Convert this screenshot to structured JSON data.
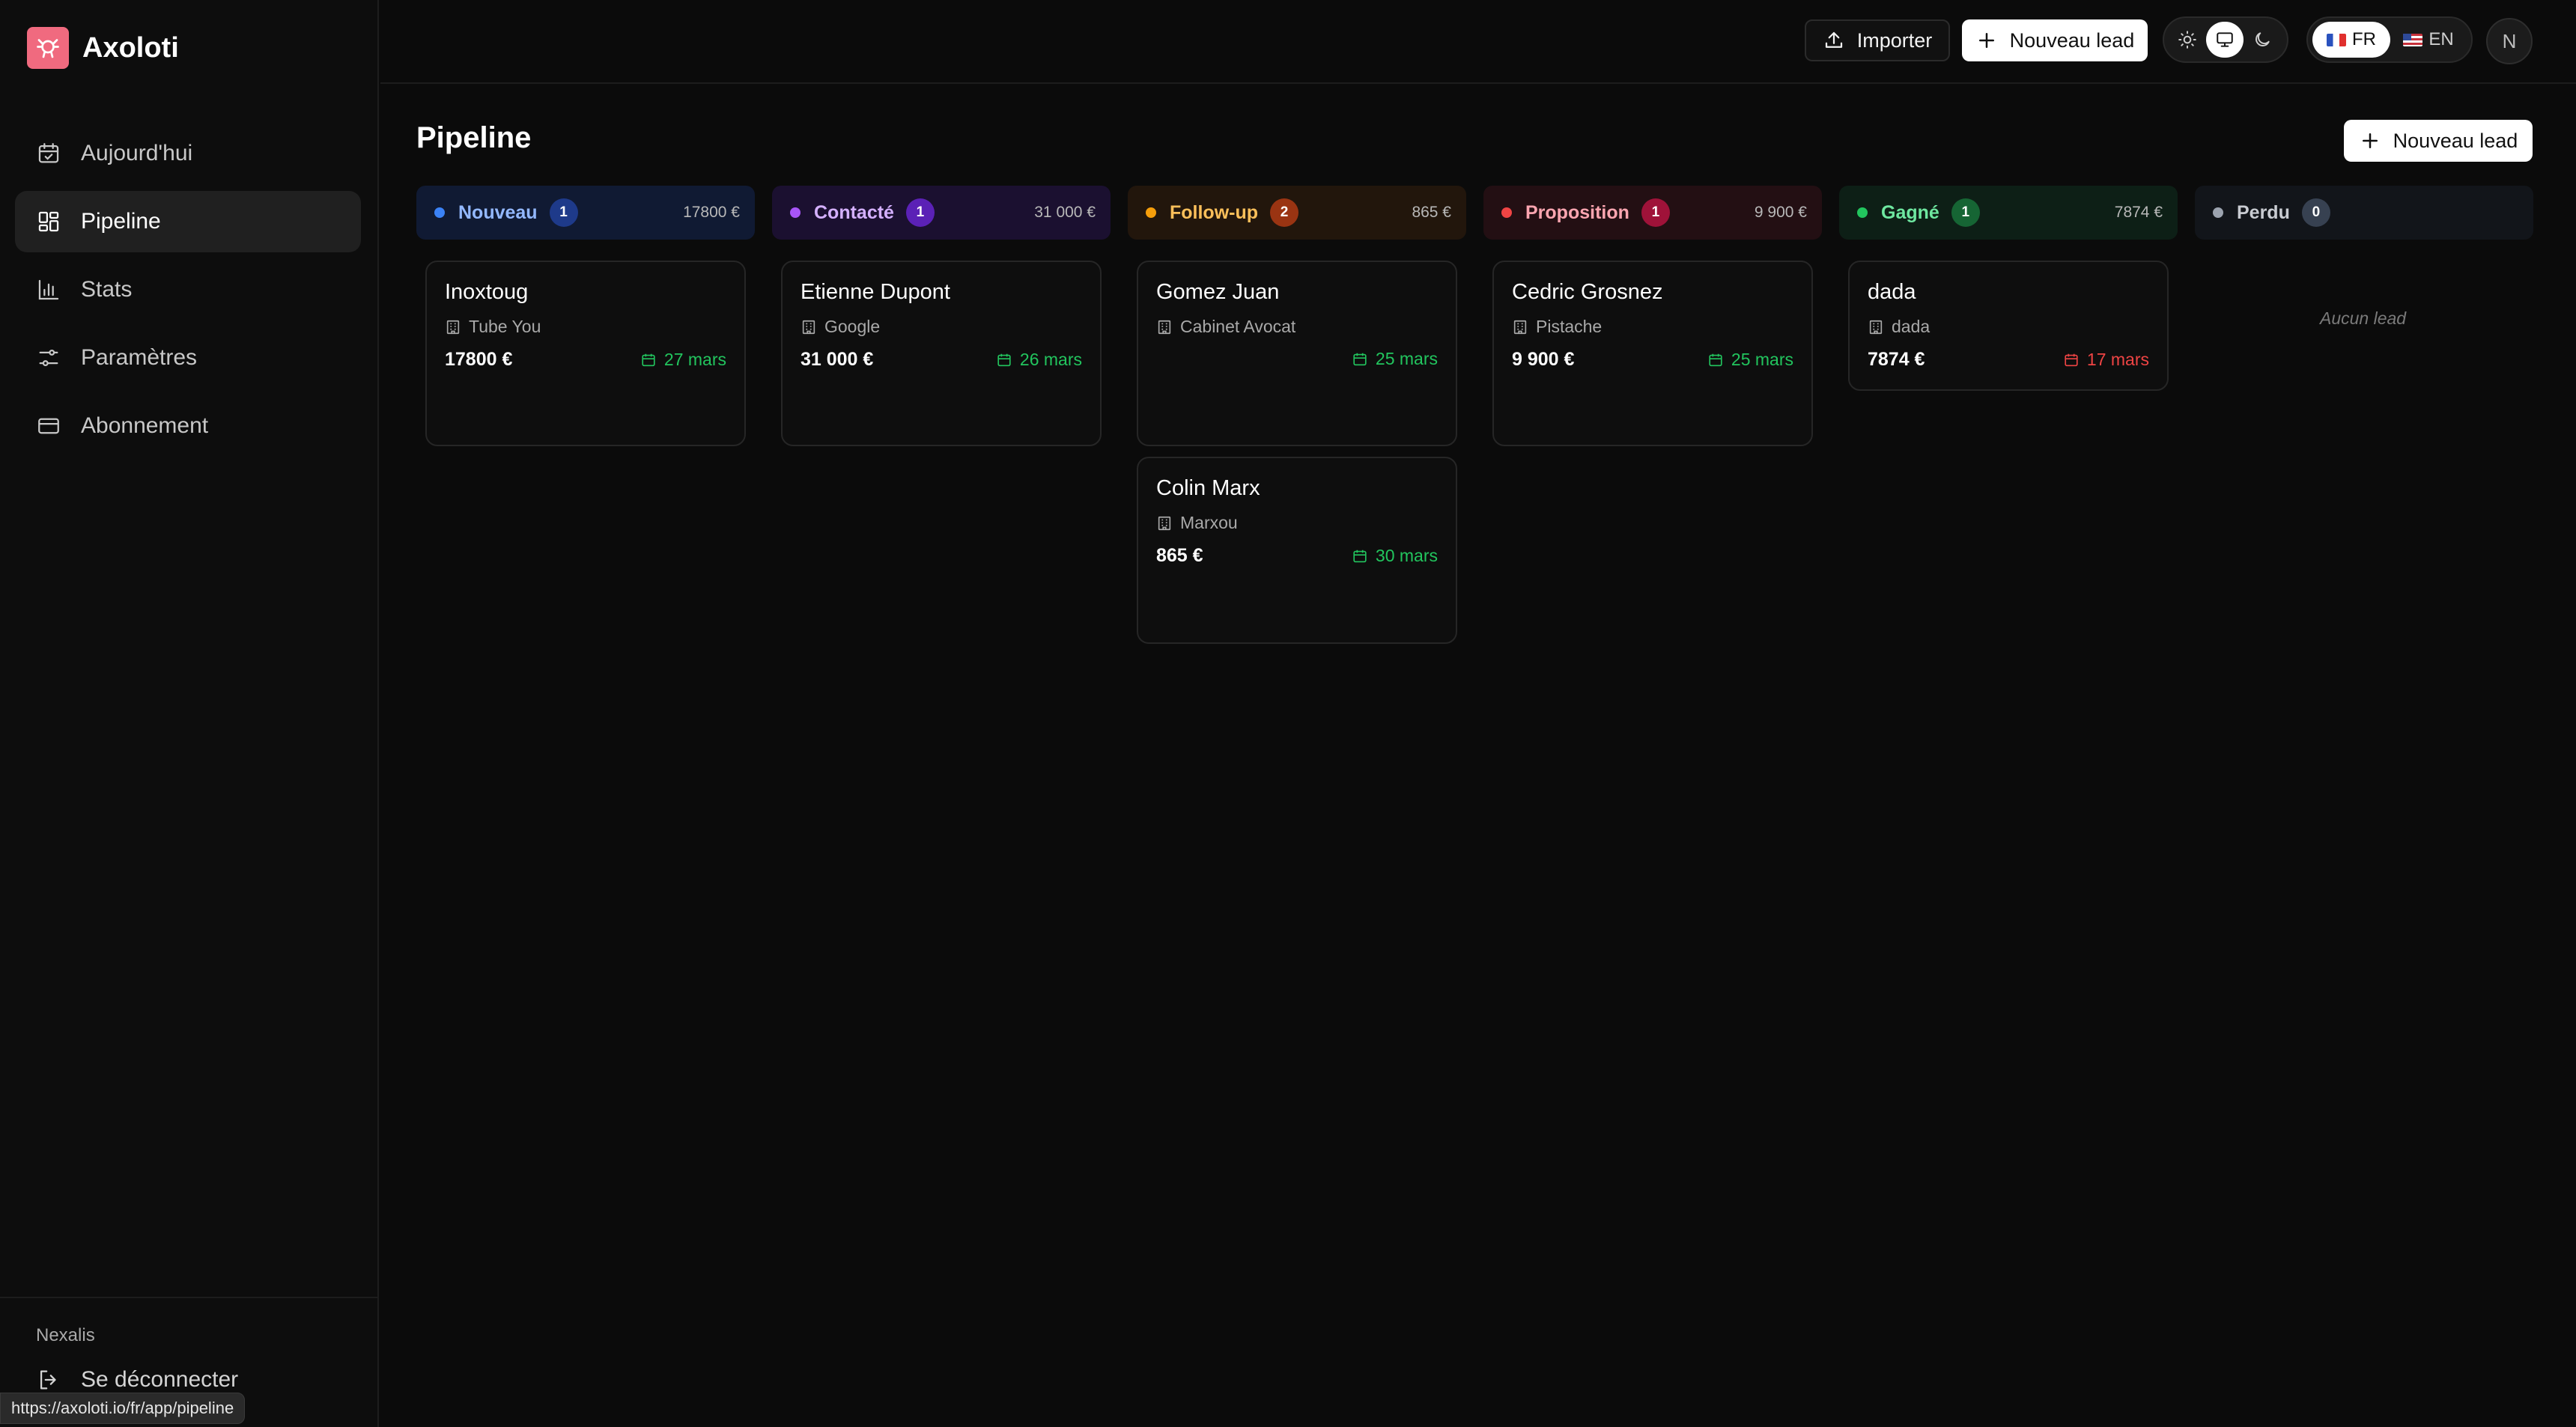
{
  "app": {
    "name": "Axoloti"
  },
  "sidebar": {
    "items": [
      {
        "label": "Aujourd'hui",
        "icon": "calendar-check-icon",
        "active": false
      },
      {
        "label": "Pipeline",
        "icon": "grid-icon",
        "active": true
      },
      {
        "label": "Stats",
        "icon": "bar-chart-icon",
        "active": false
      },
      {
        "label": "Paramètres",
        "icon": "sliders-icon",
        "active": false
      },
      {
        "label": "Abonnement",
        "icon": "credit-card-icon",
        "active": false
      }
    ],
    "org": "Nexalis",
    "logout": "Se déconnecter"
  },
  "statusbar": {
    "url": "https://axoloti.io/fr/app/pipeline"
  },
  "topbar": {
    "import_label": "Importer",
    "new_lead_label": "Nouveau lead",
    "lang_fr": "FR",
    "lang_en": "EN",
    "active_lang": "FR",
    "theme_active": "system",
    "avatar": "N"
  },
  "page": {
    "title": "Pipeline",
    "new_lead_label": "Nouveau lead"
  },
  "pipeline": {
    "columns": [
      {
        "name": "Nouveau",
        "count": "1",
        "total": "17800 €",
        "color": "#3b82f6"
      },
      {
        "name": "Contacté",
        "count": "1",
        "total": "31 000 €",
        "color": "#a855f7"
      },
      {
        "name": "Follow-up",
        "count": "2",
        "total": "865 €",
        "color": "#f59e0b"
      },
      {
        "name": "Proposition",
        "count": "1",
        "total": "9 900 €",
        "color": "#ef4444"
      },
      {
        "name": "Gagné",
        "count": "1",
        "total": "7874 €",
        "color": "#22c55e"
      },
      {
        "name": "Perdu",
        "count": "0",
        "total": "",
        "color": "#9ca3af"
      }
    ],
    "cards": [
      {
        "name": "Inoxtoug",
        "company": "Tube You",
        "value": "17800 €",
        "date": "27 mars",
        "date_status": "ok"
      },
      {
        "name": "Etienne Dupont",
        "company": "Google",
        "value": "31 000 €",
        "date": "26 mars",
        "date_status": "ok"
      },
      {
        "name": "Gomez Juan",
        "company": "Cabinet Avocat",
        "value": "",
        "date": "25 mars",
        "date_status": "ok"
      },
      {
        "name": "Colin Marx",
        "company": "Marxou",
        "value": "865 €",
        "date": "30 mars",
        "date_status": "ok"
      },
      {
        "name": "Cedric Grosnez",
        "company": "Pistache",
        "value": "9 900 €",
        "date": "25 mars",
        "date_status": "ok"
      },
      {
        "name": "dada",
        "company": "dada",
        "value": "7874 €",
        "date": "17 mars",
        "date_status": "overdue"
      }
    ],
    "empty_text": "Aucun lead"
  },
  "colors": {
    "date_ok": "#22c55e",
    "date_overdue": "#ef4444",
    "brand": "#f06a7f"
  }
}
